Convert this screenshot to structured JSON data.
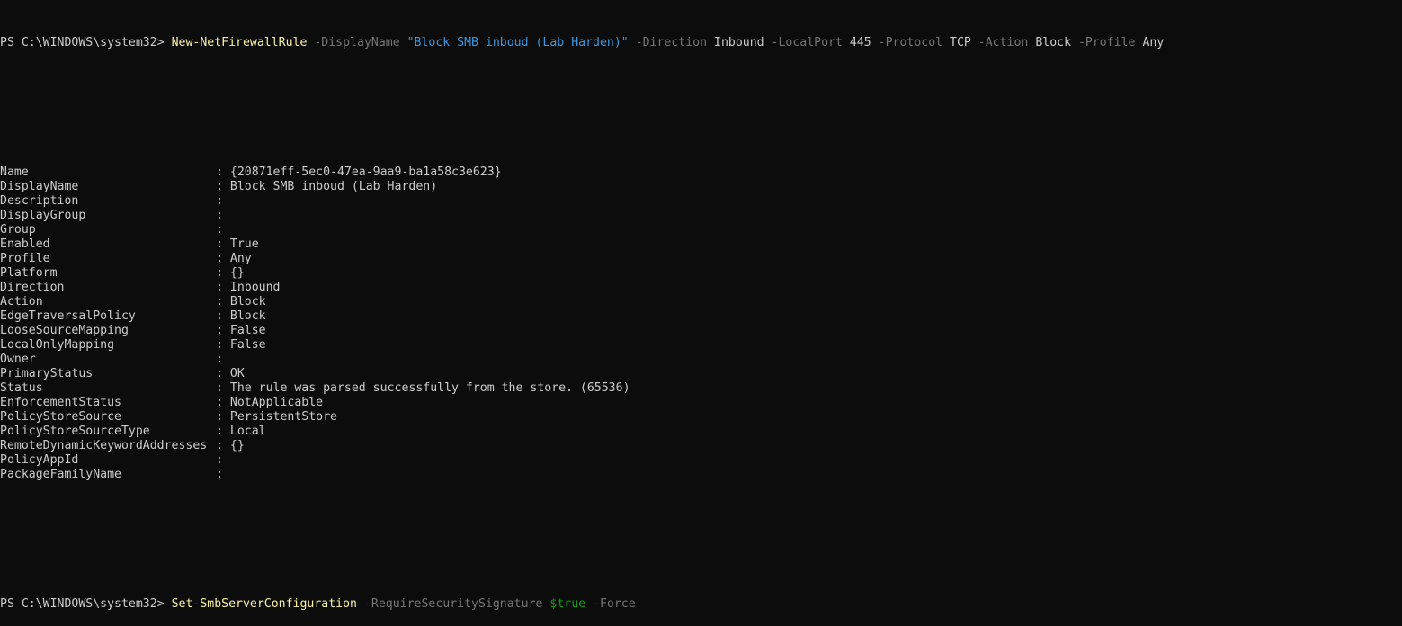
{
  "prompt": "PS C:\\WINDOWS\\system32> ",
  "command1": {
    "cmdlet": "New-NetFirewallRule",
    "tokens": [
      {
        "type": "param",
        "text": " -DisplayName "
      },
      {
        "type": "str",
        "text": "\"Block SMB inboud (Lab Harden)\""
      },
      {
        "type": "param",
        "text": " -Direction "
      },
      {
        "type": "arg",
        "text": "Inbound"
      },
      {
        "type": "param",
        "text": " -LocalPort "
      },
      {
        "type": "arg",
        "text": "445"
      },
      {
        "type": "param",
        "text": " -Protocol "
      },
      {
        "type": "arg",
        "text": "TCP"
      },
      {
        "type": "param",
        "text": " -Action "
      },
      {
        "type": "arg",
        "text": "Block"
      },
      {
        "type": "param",
        "text": " -Profile "
      },
      {
        "type": "arg",
        "text": "Any"
      }
    ]
  },
  "output": [
    {
      "name": "Name",
      "value": "{20871eff-5ec0-47ea-9aa9-ba1a58c3e623}"
    },
    {
      "name": "DisplayName",
      "value": "Block SMB inboud (Lab Harden)"
    },
    {
      "name": "Description",
      "value": ""
    },
    {
      "name": "DisplayGroup",
      "value": ""
    },
    {
      "name": "Group",
      "value": ""
    },
    {
      "name": "Enabled",
      "value": "True"
    },
    {
      "name": "Profile",
      "value": "Any"
    },
    {
      "name": "Platform",
      "value": "{}"
    },
    {
      "name": "Direction",
      "value": "Inbound"
    },
    {
      "name": "Action",
      "value": "Block"
    },
    {
      "name": "EdgeTraversalPolicy",
      "value": "Block"
    },
    {
      "name": "LooseSourceMapping",
      "value": "False"
    },
    {
      "name": "LocalOnlyMapping",
      "value": "False"
    },
    {
      "name": "Owner",
      "value": ""
    },
    {
      "name": "PrimaryStatus",
      "value": "OK"
    },
    {
      "name": "Status",
      "value": "The rule was parsed successfully from the store. (65536)"
    },
    {
      "name": "EnforcementStatus",
      "value": "NotApplicable"
    },
    {
      "name": "PolicyStoreSource",
      "value": "PersistentStore"
    },
    {
      "name": "PolicyStoreSourceType",
      "value": "Local"
    },
    {
      "name": "RemoteDynamicKeywordAddresses",
      "value": "{}"
    },
    {
      "name": "PolicyAppId",
      "value": ""
    },
    {
      "name": "PackageFamilyName",
      "value": ""
    }
  ],
  "command2": {
    "cmdlet": "Set-SmbServerConfiguration",
    "tokens": [
      {
        "type": "param",
        "text": " -RequireSecuritySignature "
      },
      {
        "type": "var",
        "text": "$true"
      },
      {
        "type": "param",
        "text": " -Force"
      }
    ]
  },
  "colors": {
    "background": "#0c0c0c",
    "foreground": "#cccccc",
    "cmdlet": "#f9f1a5",
    "parameter": "#767676",
    "string": "#3a96dd",
    "variable": "#13a10e"
  }
}
